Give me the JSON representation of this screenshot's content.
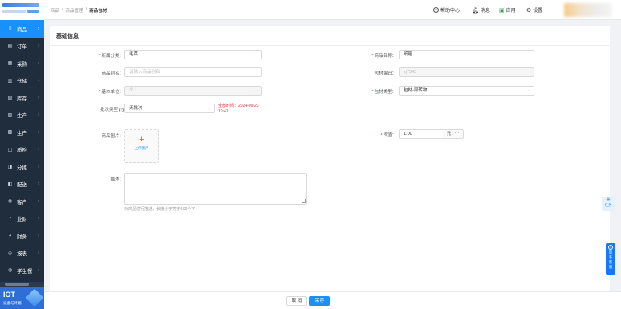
{
  "sidebar": {
    "items": [
      {
        "icon": "≡",
        "label": "商品",
        "active": true
      },
      {
        "icon": "▤",
        "label": "订单"
      },
      {
        "icon": "▦",
        "label": "采购"
      },
      {
        "icon": "▥",
        "label": "仓储"
      },
      {
        "icon": "▧",
        "label": "库存"
      },
      {
        "icon": "▨",
        "label": "生产"
      },
      {
        "icon": "▩",
        "label": "生产"
      },
      {
        "icon": "◫",
        "label": "质检"
      },
      {
        "icon": "◨",
        "label": "分拣"
      },
      {
        "icon": "◧",
        "label": "配送"
      },
      {
        "icon": "◉",
        "label": "客户"
      },
      {
        "icon": "◔",
        "label": "业财"
      },
      {
        "icon": "◕",
        "label": "财务"
      },
      {
        "icon": "◎",
        "label": "报表"
      },
      {
        "icon": "◍",
        "label": "学生餐"
      }
    ],
    "iot": {
      "title": "IOT",
      "subtitle": "设备与终端"
    }
  },
  "header": {
    "breadcrumb": [
      "商品",
      "商品管理",
      "商品包材"
    ],
    "help": "帮助中心",
    "messages": "消息",
    "apps": "应用",
    "settings": "设置"
  },
  "form": {
    "section_title": "基础信息",
    "category": {
      "label": "所属分类：",
      "value": "毛菜"
    },
    "product_name": {
      "label": "商品名称：",
      "value": "纸箱"
    },
    "alias": {
      "label": "商品别名：",
      "placeholder": "请输入商品别名"
    },
    "package_code": {
      "label": "包材编码：",
      "value": "zj7343"
    },
    "base_unit": {
      "label": "基本单位：",
      "value": "个"
    },
    "package_type": {
      "label": "包材类型：",
      "value": "包材-周转物"
    },
    "batch_type": {
      "label": "批次类型",
      "value": "无批次",
      "help": "?"
    },
    "batch_note": "全部时间：2024-09-23 10:41",
    "image": {
      "label": "商品图片：",
      "upload_label": "上传图片"
    },
    "price": {
      "label": "货值：",
      "value": "1.00",
      "unit": "元 / 个"
    },
    "description": {
      "label": "描述：",
      "hint": "对商品进行描述，长度小于等于100个字"
    }
  },
  "footer": {
    "cancel": "取 消",
    "save": "保 存"
  },
  "float": {
    "task_label": "任务",
    "service_label": [
      "联",
      "系",
      "客",
      "服"
    ]
  }
}
